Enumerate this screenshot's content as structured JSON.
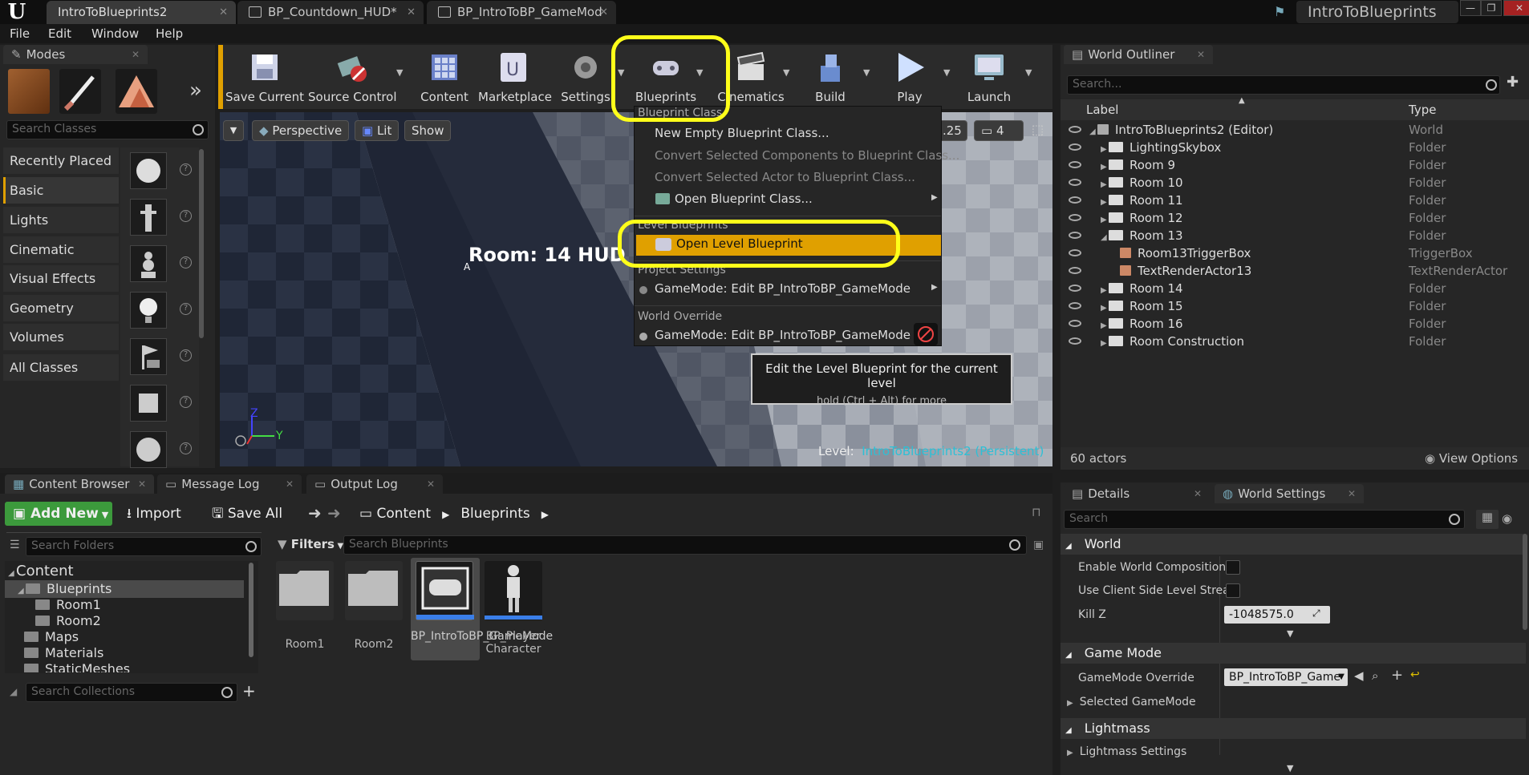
{
  "app": {
    "project_name": "IntroToBlueprints"
  },
  "tabs": [
    {
      "label": "IntroToBlueprints2"
    },
    {
      "label": "BP_Countdown_HUD*"
    },
    {
      "label": "BP_IntroToBP_GameMod"
    }
  ],
  "menu": [
    "File",
    "Edit",
    "Window",
    "Help"
  ],
  "modes": {
    "title": "Modes",
    "search_placeholder": "Search Classes",
    "categories": [
      "Recently Placed",
      "Basic",
      "Lights",
      "Cinematic",
      "Visual Effects",
      "Geometry",
      "Volumes",
      "All Classes"
    ],
    "selected_category": "Basic"
  },
  "toolbar": [
    "Save Current",
    "Source Control",
    "Content",
    "Marketplace",
    "Settings",
    "Blueprints",
    "Cinematics",
    "Build",
    "Play",
    "Launch"
  ],
  "viewport": {
    "perspective": "Perspective",
    "lit": "Lit",
    "show": "Show",
    "scale": ".25",
    "count": "4",
    "hud_text": "Room: 14 HUD",
    "level_label": "Level:",
    "level_name": "IntroToBlueprints2 (Persistent)",
    "axis_y": "Y",
    "axis_z": "Z",
    "marker": "A"
  },
  "blueprints_menu": {
    "section_class": "Blueprint Class",
    "new_empty": "New Empty Blueprint Class...",
    "convert_components": "Convert Selected Components to Blueprint Class...",
    "convert_actor": "Convert Selected Actor to Blueprint Class...",
    "open_class": "Open Blueprint Class...",
    "section_level": "Level Blueprints",
    "open_level": "Open Level Blueprint",
    "section_project": "Project Settings",
    "gamemode_project": "GameMode: Edit BP_IntroToBP_GameMode",
    "section_world": "World Override",
    "gamemode_world": "GameMode: Edit BP_IntroToBP_GameMode"
  },
  "tooltip": {
    "line1": "Edit the Level Blueprint for the current level",
    "line2": "hold (Ctrl + Alt) for more"
  },
  "outliner": {
    "title": "World Outliner",
    "search_placeholder": "Search...",
    "col_label": "Label",
    "col_type": "Type",
    "rows": [
      {
        "label": "IntroToBlueprints2 (Editor)",
        "type": "World"
      },
      {
        "label": "LightingSkybox",
        "type": "Folder"
      },
      {
        "label": "Room 9",
        "type": "Folder"
      },
      {
        "label": "Room 10",
        "type": "Folder"
      },
      {
        "label": "Room 11",
        "type": "Folder"
      },
      {
        "label": "Room 12",
        "type": "Folder"
      },
      {
        "label": "Room 13",
        "type": "Folder"
      },
      {
        "label": "Room13TriggerBox",
        "type": "TriggerBox"
      },
      {
        "label": "TextRenderActor13",
        "type": "TextRenderActor"
      },
      {
        "label": "Room 14",
        "type": "Folder"
      },
      {
        "label": "Room 15",
        "type": "Folder"
      },
      {
        "label": "Room 16",
        "type": "Folder"
      },
      {
        "label": "Room Construction",
        "type": "Folder"
      }
    ],
    "actor_count": "60 actors",
    "view_options": "View Options"
  },
  "bottom_tabs": [
    "Content Browser",
    "Message Log",
    "Output Log"
  ],
  "content_browser": {
    "add_new": "Add New",
    "import": "Import",
    "save_all": "Save All",
    "path": [
      "Content",
      "Blueprints"
    ],
    "search_folders": "Search Folders",
    "filters": "Filters",
    "search_assets": "Search Blueprints",
    "search_collections": "Search Collections",
    "tree": [
      "Content",
      "Blueprints",
      "Room1",
      "Room2",
      "Maps",
      "Materials",
      "StaticMeshes"
    ],
    "assets": [
      {
        "label": "Room1"
      },
      {
        "label": "Room2"
      },
      {
        "label": "BP_IntroToBP_GameMode"
      },
      {
        "label": "BP_Player Character"
      }
    ]
  },
  "details": {
    "tab_details": "Details",
    "tab_world": "World Settings",
    "search_placeholder": "Search",
    "world_section": "World",
    "enable_world_comp": "Enable World Composition",
    "use_client": "Use Client Side Level Strea",
    "kill_z": "Kill Z",
    "kill_z_value": "-1048575.0",
    "game_mode_section": "Game Mode",
    "gamemode_override": "GameMode Override",
    "gamemode_value": "BP_IntroToBP_Game",
    "selected_gamemode": "Selected GameMode",
    "lightmass_section": "Lightmass",
    "lightmass_settings": "Lightmass Settings"
  },
  "colors": {
    "accent": "#e0a000",
    "highlight": "#ffff1a",
    "add_new": "#3c9a3c"
  }
}
